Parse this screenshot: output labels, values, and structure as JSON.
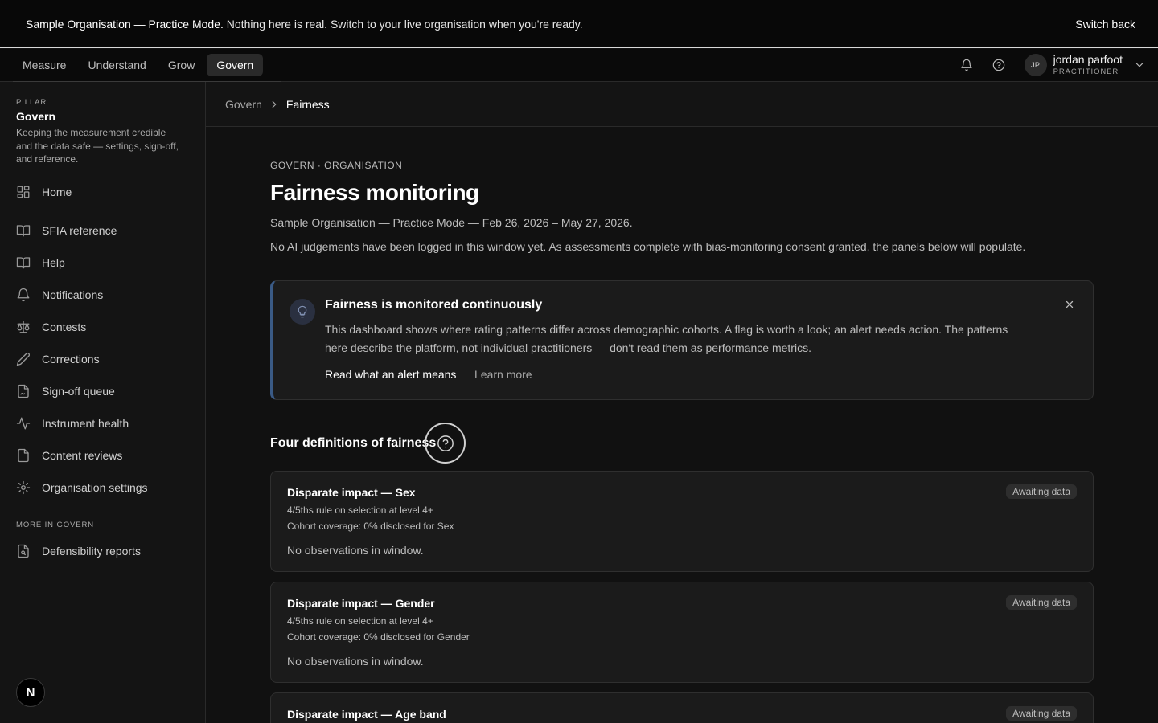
{
  "banner": {
    "strong": "Sample Organisation — Practice Mode.",
    "rest": "Nothing here is real. Switch to your live organisation when you're ready.",
    "switch_label": "Switch back"
  },
  "nav": {
    "tabs": [
      {
        "label": "Measure"
      },
      {
        "label": "Understand"
      },
      {
        "label": "Grow"
      },
      {
        "label": "Govern",
        "active": true
      }
    ],
    "notifications_icon": "bell-icon",
    "help_icon": "help-circle-icon",
    "user": {
      "initials": "JP",
      "name": "jordan parfoot",
      "role": "PRACTITIONER"
    }
  },
  "sidebar": {
    "pillar_label": "PILLAR",
    "pillar_title": "Govern",
    "pillar_desc": "Keeping the measurement credible and the data safe — settings, sign-off, and reference.",
    "items": [
      {
        "label": "Home",
        "icon": "dashboard-icon"
      },
      {
        "label": "SFIA reference",
        "icon": "book-icon"
      },
      {
        "label": "Help",
        "icon": "book-open-icon"
      },
      {
        "label": "Notifications",
        "icon": "bell-icon"
      },
      {
        "label": "Contests",
        "icon": "scale-icon"
      },
      {
        "label": "Corrections",
        "icon": "pencil-icon"
      },
      {
        "label": "Sign-off queue",
        "icon": "file-signature-icon"
      },
      {
        "label": "Instrument health",
        "icon": "activity-icon"
      },
      {
        "label": "Content reviews",
        "icon": "file-check-icon"
      },
      {
        "label": "Organisation settings",
        "icon": "gear-icon"
      }
    ],
    "more_label": "MORE IN GOVERN",
    "more_items": [
      {
        "label": "Defensibility reports",
        "icon": "file-search-icon"
      }
    ],
    "badge": "N"
  },
  "breadcrumb": {
    "parent": "Govern",
    "current": "Fairness"
  },
  "page": {
    "eyebrow": "GOVERN · ORGANISATION",
    "title": "Fairness monitoring",
    "subtitle": "Sample Organisation — Practice Mode — Feb 26, 2026 – May 27, 2026.",
    "intro": "No AI judgements have been logged in this window yet. As assessments complete with bias-monitoring consent granted, the panels below will populate."
  },
  "callout": {
    "title": "Fairness is monitored continuously",
    "body": "This dashboard shows where rating patterns differ across demographic cohorts. A flag is worth a look; an alert needs action. The patterns here describe the platform, not individual practitioners — don't read them as performance metrics.",
    "link_primary": "Read what an alert means",
    "link_secondary": "Learn more",
    "icon": "lightbulb-icon",
    "accent_color": "#3a5a85"
  },
  "section": {
    "heading": "Four definitions of fairness"
  },
  "cards": [
    {
      "title": "Disparate impact — Sex",
      "rule": "4/5ths rule on selection at level 4+",
      "coverage": "Cohort coverage: 0% disclosed for Sex",
      "empty": "No observations in window.",
      "badge": "Awaiting data"
    },
    {
      "title": "Disparate impact — Gender",
      "rule": "4/5ths rule on selection at level 4+",
      "coverage": "Cohort coverage: 0% disclosed for Gender",
      "empty": "No observations in window.",
      "badge": "Awaiting data"
    },
    {
      "title": "Disparate impact — Age band",
      "badge": "Awaiting data"
    }
  ]
}
